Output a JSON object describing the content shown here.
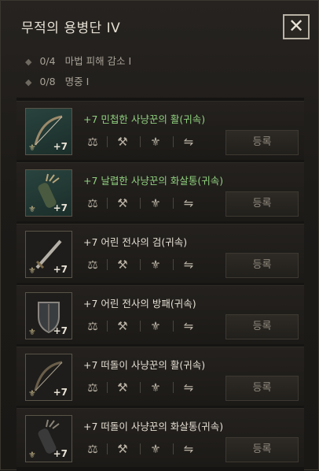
{
  "window": {
    "title": "무적의 용병단 IV",
    "close_icon": "close-icon"
  },
  "stats": [
    {
      "value": "0/4",
      "label": "마법 피해 감소 Ⅰ"
    },
    {
      "value": "0/8",
      "label": "명중 Ⅰ"
    }
  ],
  "items": [
    {
      "name": "+7 민첩한 사냥꾼의 활(귀속)",
      "level": "+7",
      "register": "등록",
      "name_color": "#8fd07e",
      "icon": "bow-icon"
    },
    {
      "name": "+7 날렵한 사냥꾼의 화살통(귀속)",
      "level": "+7",
      "register": "등록",
      "name_color": "#8fd07e",
      "icon": "quiver-icon"
    },
    {
      "name": "+7 어린 전사의 검(귀속)",
      "level": "+7",
      "register": "등록",
      "name_color": "#e4ded2",
      "icon": "sword-icon"
    },
    {
      "name": "+7 어린 전사의 방패(귀속)",
      "level": "+7",
      "register": "등록",
      "name_color": "#e4ded2",
      "icon": "shield-icon"
    },
    {
      "name": "+7 떠돌이 사냥꾼의 활(귀속)",
      "level": "+7",
      "register": "등록",
      "name_color": "#e4ded2",
      "icon": "bow-icon"
    },
    {
      "name": "+7 떠돌이 사냥꾼의 화살통(귀속)",
      "level": "+7",
      "register": "등록",
      "name_color": "#e4ded2",
      "icon": "quiver-icon"
    }
  ]
}
